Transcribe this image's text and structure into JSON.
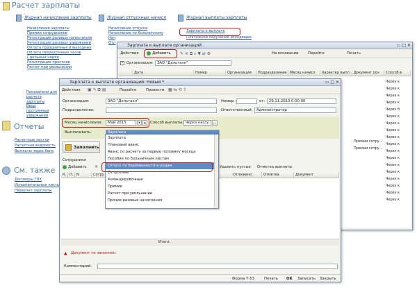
{
  "page": {
    "title": "Расчет зарплаты",
    "journals": [
      {
        "title": "Журнал начисление зарплаты",
        "links": [
          "Начисление зарплаты",
          "Премии сотрудников",
          "Регистрация разовых начислений",
          "Регистрация разовых удержаний",
          "Оплата праздничных и выходных",
          "Оплата сверхурочных часов",
          "Сдельный наряд",
          "Регистрация простоев",
          "Расчет при увольнении"
        ]
      },
      {
        "title": "Журнал отпускных начисл",
        "links": [
          "Начисление отпуска",
          "Начисление по больничному",
          "Нач",
          "Отп"
        ]
      },
      {
        "title": "Журнал выплаты зарплаты",
        "links": [
          "Зарплата к выплате",
          "Платежное поручение исходящее"
        ]
      }
    ],
    "extra_links": [
      "Показатели для расчета зарплаты",
      "Ввод постоянных удержаний"
    ],
    "reports": {
      "title": "Отчеты",
      "links": [
        "Расчетные листки",
        "Расчетная ведомость",
        "Выплаты через банк"
      ]
    },
    "see_also": {
      "title": "См. также",
      "links": [
        "Договоры ГПХ",
        "Исполнительные листы",
        "Пересчет зарплаты"
      ]
    }
  },
  "list_window": {
    "title": "Зарплата к выплате организаций",
    "toolbar": {
      "actions": "Действия",
      "add": "Добавить",
      "based_on": "На основании",
      "goto": "Перейти",
      "print": "Печать"
    },
    "filter": {
      "label": "Организация:",
      "value": "ЗАО \"Дельтаэн\""
    },
    "columns": [
      "Дата",
      "Номер",
      "Организация",
      "Подразделение",
      "Месяц начисл",
      "Характер выпл",
      "Документ осн",
      "Способ в"
    ],
    "row_values": [
      "Через к",
      "Через к",
      "Через к",
      "Через к",
      "Через б",
      "Через к",
      "Через к",
      "Через к",
      "Через к",
      "Через к",
      "Через к",
      "Через к",
      "Через к",
      "Через к",
      "Через к",
      "Через к",
      "Через к",
      "Через к"
    ],
    "row_docs": [
      "Премии сотру...",
      "Премии сотру..."
    ]
  },
  "doc_window": {
    "title": "Зарплата к выплате организаций: Новый *",
    "toolbar": {
      "actions": "Действия",
      "goto": "Перейти",
      "post": "Провести"
    },
    "fields": {
      "org_label": "Организация:",
      "org_value": "ЗАО \"Дельтаэн\"",
      "number_label": "Номер:",
      "date_label": "от:",
      "date_value": "29.11.2013 0:00:00",
      "dept_label": "Подразделение:",
      "responsible_label": "Ответственный:",
      "responsible_value": "Администратор",
      "month_label": "Месяц начисления:",
      "month_value": "Май 2013",
      "method_label": "Способ выплаты:",
      "method_value": "Через кассу",
      "pay_label": "Выплачивать:",
      "pay_value": "Зарплата"
    },
    "fill_button": "Заполнить",
    "employees": {
      "title": "Сотрудники",
      "add": "Добавить",
      "delete_empty": "Удалить пустые",
      "mark_paid": "Отметка выплаты",
      "columns": [
        "К.",
        "П.",
        "N",
        "Сотру",
        "Отложено",
        "Отметка",
        "Документ"
      ],
      "total_label": "Итого:"
    },
    "dropdown_items": [
      "Зарплата",
      "Плановый аванс",
      "Аванс по расчету за первую половину месяца",
      "Пособия по больничным листам",
      "Отпуск по беременности и родам",
      "Отпускные",
      "Командировочные",
      "Премии",
      "Расчет при увольнении",
      "Прочие разовые начисления"
    ],
    "dropdown_selected": "Отпуск по беременности и родам",
    "warning": "Документ не заполнен.",
    "comment_label": "Комментарий:",
    "footer": {
      "form": "Форма Т-53",
      "print": "Печать",
      "ok": "OK",
      "save": "Записать",
      "close": "Закрыть"
    }
  },
  "colors": {
    "link": "#1a4f9c",
    "highlight": "#d01818",
    "selected": "#5d8bc7",
    "warning": "#c01010"
  }
}
